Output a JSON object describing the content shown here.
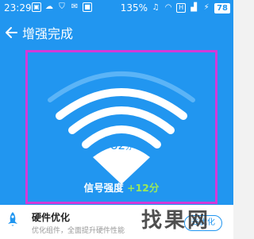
{
  "status_bar": {
    "time": "23:29",
    "left_icons": [
      "image-icon",
      "cloud-icon",
      "shield-icon",
      "email-icon",
      "app-badge-icon"
    ],
    "network_speed": "135",
    "speed_unit": "%",
    "right_icons": [
      "headphone-icon",
      "wifi-icon",
      "hd-icon",
      "signal-icon",
      "charging-icon"
    ],
    "battery": "78"
  },
  "header": {
    "title": "增强完成"
  },
  "wifi_result": {
    "score": "82",
    "score_unit": "分",
    "strength_label": "信号强度",
    "strength_delta": "+12分"
  },
  "card": {
    "title": "硬件优化",
    "description": "优化组件，全面提升硬件性能",
    "button_label": "去优化"
  },
  "watermark": {
    "text": "找果网"
  },
  "colors": {
    "primary_blue": "#2196f0",
    "highlight_frame": "#d23ad8",
    "delta_green": "#9be85a"
  }
}
